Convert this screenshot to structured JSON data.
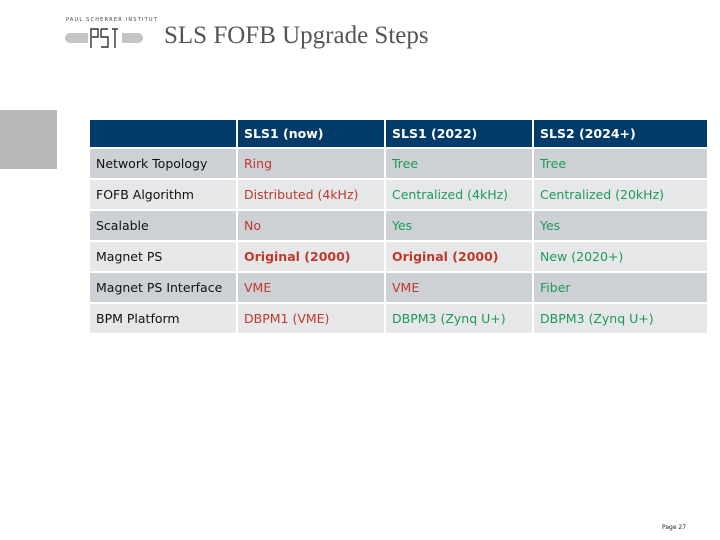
{
  "header": {
    "logo_text": "PAUL SCHERRER INSTITUT",
    "logo_mark": "PSI",
    "title": "SLS FOFB Upgrade Steps"
  },
  "colors": {
    "header_bg": "#003b6a",
    "row_odd": "#cdd0d5",
    "row_even": "#e6e7e9",
    "bad": "#c0392b",
    "good": "#1e9b58"
  },
  "table": {
    "columns": [
      "",
      "SLS1 (now)",
      "SLS1 (2022)",
      "SLS2 (2024+)"
    ],
    "rows": [
      {
        "label": "Network Topology",
        "cells": [
          {
            "text": "Ring",
            "status": "red"
          },
          {
            "text": "Tree",
            "status": "green"
          },
          {
            "text": "Tree",
            "status": "green"
          }
        ]
      },
      {
        "label": "FOFB Algorithm",
        "cells": [
          {
            "text": "Distributed (4kHz)",
            "status": "red"
          },
          {
            "text": "Centralized (4kHz)",
            "status": "green"
          },
          {
            "text": "Centralized (20kHz)",
            "status": "green"
          }
        ]
      },
      {
        "label": "Scalable",
        "cells": [
          {
            "text": "No",
            "status": "red"
          },
          {
            "text": "Yes",
            "status": "green"
          },
          {
            "text": "Yes",
            "status": "green"
          }
        ]
      },
      {
        "label": "Magnet PS",
        "cells": [
          {
            "text": "Original (2000)",
            "status": "red",
            "bold": true
          },
          {
            "text": "Original (2000)",
            "status": "red",
            "bold": true
          },
          {
            "text": "New (2020+)",
            "status": "green"
          }
        ]
      },
      {
        "label": "Magnet PS Interface",
        "cells": [
          {
            "text": "VME",
            "status": "red"
          },
          {
            "text": "VME",
            "status": "red"
          },
          {
            "text": "Fiber",
            "status": "green"
          }
        ]
      },
      {
        "label": "BPM Platform",
        "cells": [
          {
            "text": "DBPM1 (VME)",
            "status": "red"
          },
          {
            "text": "DBPM3 (Zynq U+)",
            "status": "green"
          },
          {
            "text": "DBPM3 (Zynq U+)",
            "status": "green"
          }
        ]
      }
    ]
  },
  "footer": {
    "page_label": "Page 27"
  }
}
